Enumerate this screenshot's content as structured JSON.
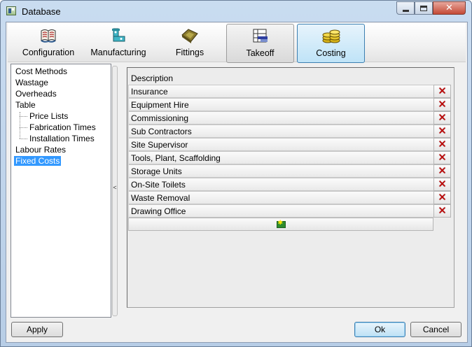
{
  "window": {
    "title": "Database"
  },
  "toolbar": {
    "tools": [
      {
        "label": "Configuration",
        "icon": "books-icon"
      },
      {
        "label": "Manufacturing",
        "icon": "pipe-fitting-icon"
      },
      {
        "label": "Fittings",
        "icon": "fittings-icon"
      },
      {
        "label": "Takeoff",
        "icon": "takeoff-icon"
      },
      {
        "label": "Costing",
        "icon": "coins-icon"
      }
    ],
    "selected": "Costing"
  },
  "tree": {
    "items": [
      {
        "label": "Cost Methods"
      },
      {
        "label": "Wastage"
      },
      {
        "label": "Overheads"
      },
      {
        "label": "Table"
      },
      {
        "label": "Price Lists"
      },
      {
        "label": "Fabrication Times"
      },
      {
        "label": "Installation Times"
      },
      {
        "label": "Labour Rates"
      },
      {
        "label": "Fixed Costs"
      }
    ],
    "selected": "Fixed Costs"
  },
  "grid": {
    "header": "Description",
    "rows": [
      "Insurance",
      "Equipment Hire",
      "Commissioning",
      "Sub Contractors",
      "Site Supervisor",
      "Tools, Plant, Scaffolding",
      "Storage Units",
      "On-Site Toilets",
      "Waste Removal",
      "Drawing Office"
    ],
    "delete_icon": "delete-x-icon",
    "add_icon": "add-row-icon"
  },
  "buttons": {
    "apply": "Apply",
    "ok": "Ok",
    "cancel": "Cancel"
  },
  "colors": {
    "selection": "#3399ff",
    "delete_icon": "#c00000",
    "close_button": "#c44a36"
  }
}
